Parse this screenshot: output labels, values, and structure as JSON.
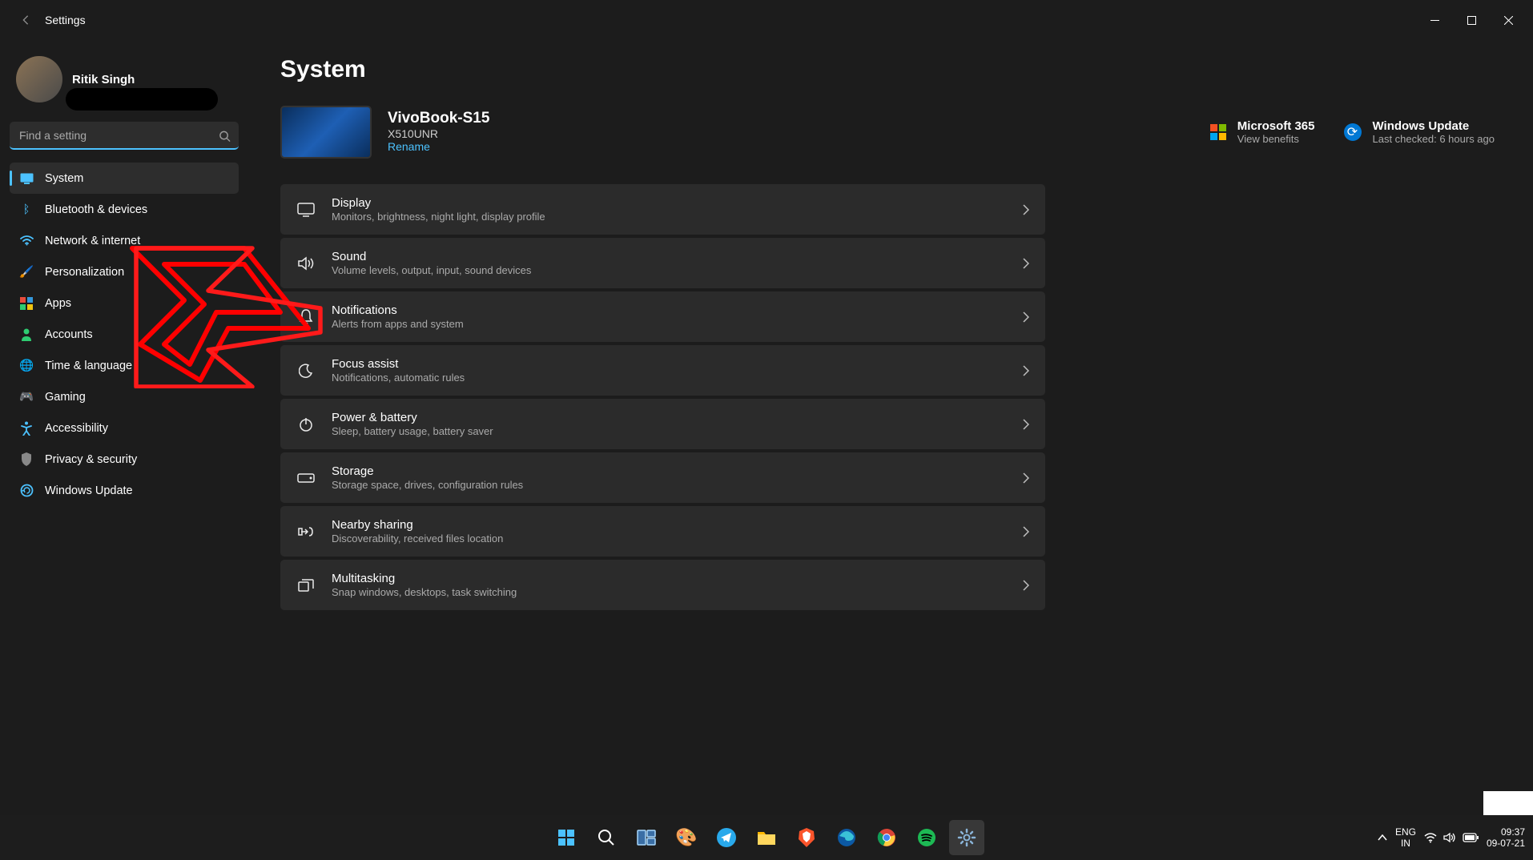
{
  "window": {
    "title": "Settings"
  },
  "user": {
    "name": "Ritik Singh"
  },
  "search": {
    "placeholder": "Find a setting"
  },
  "nav": [
    {
      "label": "System",
      "icon": "system",
      "active": true
    },
    {
      "label": "Bluetooth & devices",
      "icon": "bluetooth",
      "active": false
    },
    {
      "label": "Network & internet",
      "icon": "wifi",
      "active": false
    },
    {
      "label": "Personalization",
      "icon": "brush",
      "active": false
    },
    {
      "label": "Apps",
      "icon": "apps",
      "active": false
    },
    {
      "label": "Accounts",
      "icon": "person",
      "active": false
    },
    {
      "label": "Time & language",
      "icon": "globe",
      "active": false
    },
    {
      "label": "Gaming",
      "icon": "gamepad",
      "active": false
    },
    {
      "label": "Accessibility",
      "icon": "accessibility",
      "active": false
    },
    {
      "label": "Privacy & security",
      "icon": "shield",
      "active": false
    },
    {
      "label": "Windows Update",
      "icon": "update",
      "active": false
    }
  ],
  "page": {
    "title": "System",
    "device_name": "VivoBook-S15",
    "device_model": "X510UNR",
    "rename": "Rename",
    "ms365_title": "Microsoft 365",
    "ms365_sub": "View benefits",
    "update_title": "Windows Update",
    "update_sub": "Last checked: 6 hours ago"
  },
  "settings": [
    {
      "title": "Display",
      "desc": "Monitors, brightness, night light, display profile",
      "icon": "display"
    },
    {
      "title": "Sound",
      "desc": "Volume levels, output, input, sound devices",
      "icon": "sound"
    },
    {
      "title": "Notifications",
      "desc": "Alerts from apps and system",
      "icon": "bell"
    },
    {
      "title": "Focus assist",
      "desc": "Notifications, automatic rules",
      "icon": "moon"
    },
    {
      "title": "Power & battery",
      "desc": "Sleep, battery usage, battery saver",
      "icon": "power"
    },
    {
      "title": "Storage",
      "desc": "Storage space, drives, configuration rules",
      "icon": "storage"
    },
    {
      "title": "Nearby sharing",
      "desc": "Discoverability, received files location",
      "icon": "share"
    },
    {
      "title": "Multitasking",
      "desc": "Snap windows, desktops, task switching",
      "icon": "multitask"
    }
  ],
  "taskbar": {
    "lang1": "ENG",
    "lang2": "IN",
    "time": "09:37",
    "date": "09-07-21"
  }
}
